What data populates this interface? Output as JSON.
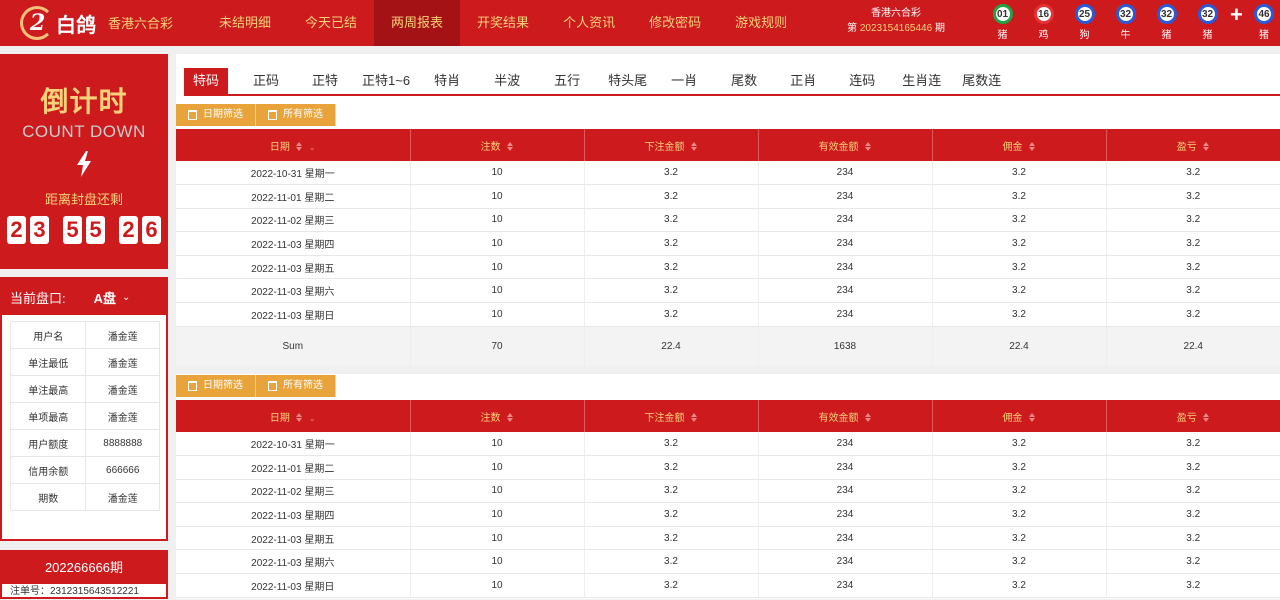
{
  "header": {
    "logo_text": "白鸽",
    "logo_mark": "2",
    "lottery_name": "香港六合彩",
    "nav": [
      "未结明细",
      "今天已结",
      "两周报表",
      "开奖结果",
      "个人资讯",
      "修改密码",
      "游戏规则"
    ],
    "active_nav": "两周报表",
    "period_title": "香港六合彩",
    "period_prefix": "第",
    "period_number": "2023154165446",
    "period_suffix": "期",
    "balls": [
      {
        "num": "01",
        "zodiac": "猪",
        "color": "green"
      },
      {
        "num": "16",
        "zodiac": "鸡",
        "color": "red"
      },
      {
        "num": "25",
        "zodiac": "狗",
        "color": "blue"
      },
      {
        "num": "32",
        "zodiac": "牛",
        "color": "blue"
      },
      {
        "num": "32",
        "zodiac": "猪",
        "color": "blue"
      },
      {
        "num": "32",
        "zodiac": "猪",
        "color": "blue"
      }
    ],
    "plus": "+",
    "special_ball": {
      "num": "46",
      "zodiac": "猪",
      "color": "blue"
    }
  },
  "countdown": {
    "title": "倒计时",
    "subtitle": "COUNT DOWN",
    "label": "距离封盘还剩",
    "digits": [
      "2",
      "3",
      "5",
      "5",
      "2",
      "6"
    ]
  },
  "pan": {
    "label": "当前盘口:",
    "value": "A盘",
    "rows": [
      [
        "用户名",
        "潘金莲"
      ],
      [
        "单注最低",
        "潘金莲"
      ],
      [
        "单注最高",
        "潘金莲"
      ],
      [
        "单项最高",
        "潘金莲"
      ],
      [
        "用户额度",
        "8888888"
      ],
      [
        "信用余额",
        "666666"
      ],
      [
        "期数",
        "潘金莲"
      ]
    ]
  },
  "order": {
    "period": "202266666期",
    "line": "注单号：2312315643512221"
  },
  "tabs": [
    "特码",
    "正码",
    "正特",
    "正特1~6",
    "特肖",
    "半波",
    "五行",
    "特头尾",
    "一肖",
    "尾数",
    "正肖",
    "连码",
    "生肖连",
    "尾数连"
  ],
  "active_tab": "特码",
  "filters": [
    "日期筛选",
    "所有筛选"
  ],
  "table": {
    "columns": [
      "日期",
      "注数",
      "下注金额",
      "有效金额",
      "佣金",
      "盈亏"
    ],
    "rows": [
      [
        "2022-10-31 星期一",
        "10",
        "3.2",
        "234",
        "3.2",
        "3.2"
      ],
      [
        "2022-11-01 星期二",
        "10",
        "3.2",
        "234",
        "3.2",
        "3.2"
      ],
      [
        "2022-11-02 星期三",
        "10",
        "3.2",
        "234",
        "3.2",
        "3.2"
      ],
      [
        "2022-11-03 星期四",
        "10",
        "3.2",
        "234",
        "3.2",
        "3.2"
      ],
      [
        "2022-11-03 星期五",
        "10",
        "3.2",
        "234",
        "3.2",
        "3.2"
      ],
      [
        "2022-11-03 星期六",
        "10",
        "3.2",
        "234",
        "3.2",
        "3.2"
      ],
      [
        "2022-11-03 星期日",
        "10",
        "3.2",
        "234",
        "3.2",
        "3.2"
      ]
    ],
    "sum": [
      "Sum",
      "70",
      "22.4",
      "1638",
      "22.4",
      "22.4"
    ]
  },
  "table2": {
    "columns": [
      "日期",
      "注数",
      "下注金额",
      "有效金额",
      "佣金",
      "盈亏"
    ],
    "rows": [
      [
        "2022-10-31 星期一",
        "10",
        "3.2",
        "234",
        "3.2",
        "3.2"
      ],
      [
        "2022-11-01 星期二",
        "10",
        "3.2",
        "234",
        "3.2",
        "3.2"
      ],
      [
        "2022-11-02 星期三",
        "10",
        "3.2",
        "234",
        "3.2",
        "3.2"
      ],
      [
        "2022-11-03 星期四",
        "10",
        "3.2",
        "234",
        "3.2",
        "3.2"
      ],
      [
        "2022-11-03 星期五",
        "10",
        "3.2",
        "234",
        "3.2",
        "3.2"
      ],
      [
        "2022-11-03 星期六",
        "10",
        "3.2",
        "234",
        "3.2",
        "3.2"
      ],
      [
        "2022-11-03 星期日",
        "10",
        "3.2",
        "234",
        "3.2",
        "3.2"
      ]
    ]
  },
  "colors": {
    "brand_red": "#cc1a1d",
    "active_nav": "#a51216",
    "gold_text": "#f6d27a",
    "filter_orange": "#e8a33a"
  }
}
